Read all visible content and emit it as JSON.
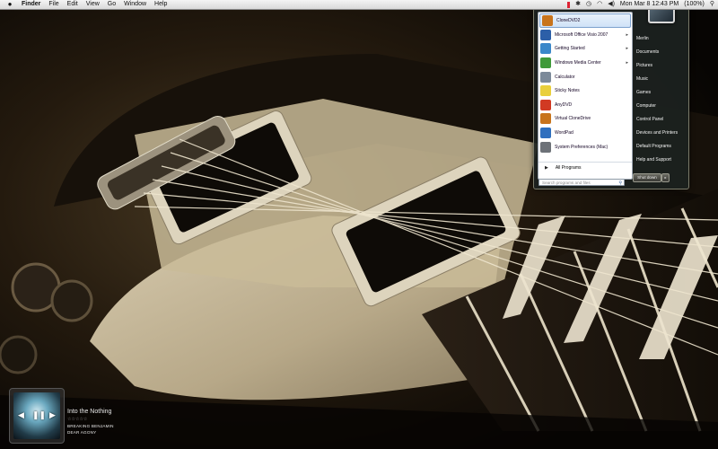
{
  "menubar": {
    "apple": "",
    "app": "Finder",
    "items": [
      "File",
      "Edit",
      "View",
      "Go",
      "Window",
      "Help"
    ],
    "clock": "Mon Mar 8  12:43 PM",
    "battery": "(100%)"
  },
  "start_menu": {
    "programs": [
      {
        "label": "CloneDVD2",
        "icon": "clonedvd-icon",
        "color": "#c8741c",
        "arrow": false
      },
      {
        "label": "Microsoft Office Visio 2007",
        "icon": "visio-icon",
        "color": "#2c5fa8",
        "arrow": true
      },
      {
        "label": "Getting Started",
        "icon": "getting-started-icon",
        "color": "#3a87c9",
        "arrow": true
      },
      {
        "label": "Windows Media Center",
        "icon": "media-center-icon",
        "color": "#3f9a3a",
        "arrow": true
      },
      {
        "label": "Calculator",
        "icon": "calculator-icon",
        "color": "#7c8a9a",
        "arrow": false
      },
      {
        "label": "Sticky Notes",
        "icon": "sticky-notes-icon",
        "color": "#e9cf3c",
        "arrow": false
      },
      {
        "label": "AnyDVD",
        "icon": "anydvd-icon",
        "color": "#d13a23",
        "arrow": false
      },
      {
        "label": "Virtual CloneDrive",
        "icon": "virtual-clonedrive-icon",
        "color": "#c8741c",
        "arrow": false
      },
      {
        "label": "WordPad",
        "icon": "wordpad-icon",
        "color": "#2f6fbe",
        "arrow": false
      },
      {
        "label": "System Preferences (Mac)",
        "icon": "system-preferences-icon",
        "color": "#6d7278",
        "arrow": false
      }
    ],
    "all_programs": "All Programs",
    "search_placeholder": "Search programs and files",
    "right_items": [
      "Merlin",
      "Documents",
      "Pictures",
      "Music",
      "Games",
      "Computer",
      "Control Panel",
      "Devices and Printers",
      "Default Programs",
      "Help and Support"
    ],
    "shutdown": "Shut down"
  },
  "player": {
    "title": "Into the Nothing",
    "rating": "☆☆☆☆☆",
    "artist": "BREAKING BENJAMIN",
    "album": "DEAR AGONY"
  }
}
